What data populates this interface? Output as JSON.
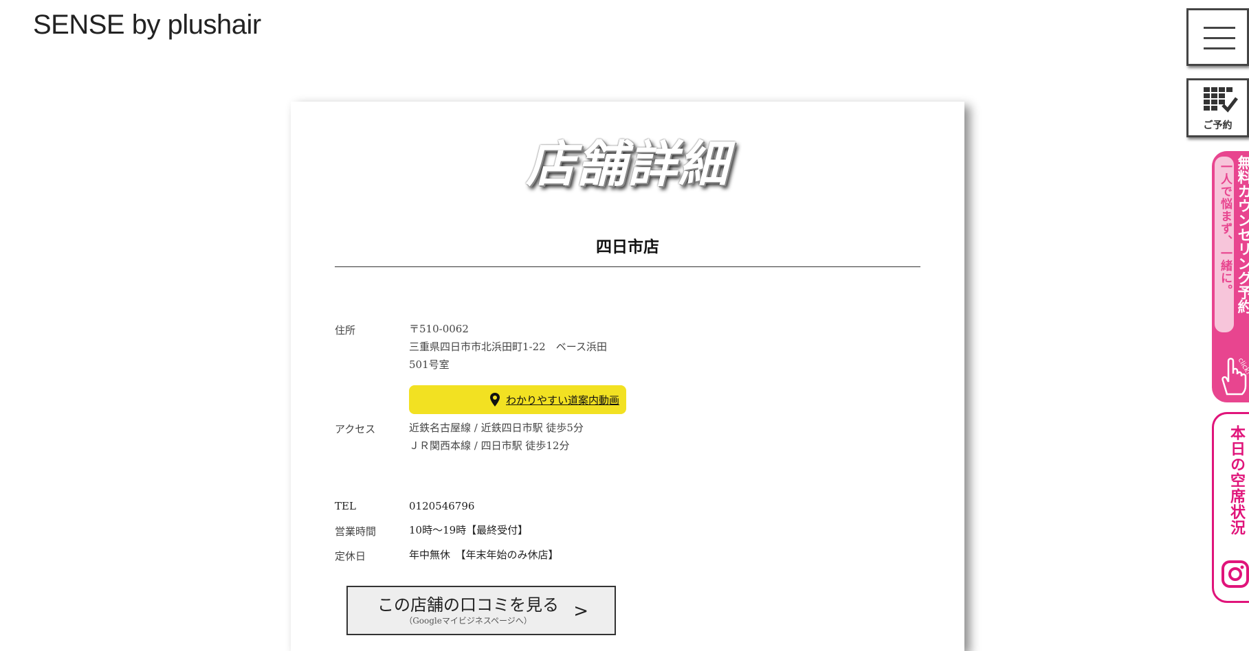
{
  "header": {
    "logo": "SENSE by plushair"
  },
  "page": {
    "title": "店舗詳細",
    "store_name": "四日市店"
  },
  "details": {
    "address": {
      "label": "住所",
      "postal": "〒510-0062",
      "line1": "三重県四日市市北浜田町1-22　ベース浜田",
      "line2": "501号室"
    },
    "map_button": {
      "label": "わかりやすい道案内動画",
      "icon": "map-pin-icon"
    },
    "access": {
      "label": "アクセス",
      "line1": "近鉄名古屋線 / 近鉄四日市駅 徒歩5分",
      "line2": "ＪＲ関西本線 / 四日市駅 徒歩12分"
    },
    "tel": {
      "label": "TEL",
      "value": "0120546796"
    },
    "hours": {
      "label": "営業時間",
      "value": "10時〜19時【最終受付】"
    },
    "holiday": {
      "label": "定休日",
      "value": "年中無休　【年末年始のみ休店】"
    }
  },
  "review_button": {
    "label": "この店舗の口コミを見る",
    "sub": "（Googleマイビジネスページへ）",
    "arrow": ">"
  },
  "side": {
    "menu_icon": "hamburger-menu-icon",
    "reserve": {
      "label": "ご予約",
      "icon": "calendar-check-icon"
    },
    "counsel": {
      "main": "無料カウンセリング予約",
      "sub": "一人で悩まず、一緒に。",
      "click": "click!",
      "icon": "pointing-hand-icon"
    },
    "vacancy": {
      "label": "本日の空席状況",
      "icon": "instagram-icon"
    }
  },
  "colors": {
    "accent_yellow": "#f2e122",
    "accent_pink": "#e8458f",
    "accent_magenta": "#e0147a"
  }
}
